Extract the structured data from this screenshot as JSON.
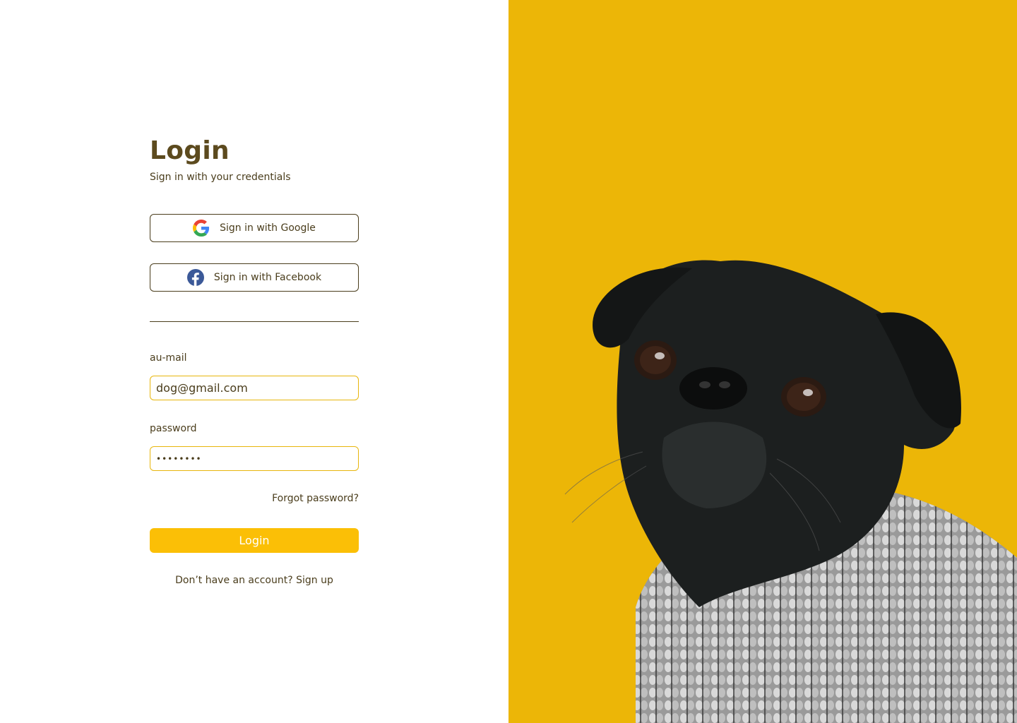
{
  "login": {
    "title": "Login",
    "subtitle": "Sign in with your credentials",
    "google_button": "Sign in with Google",
    "facebook_button": "Sign in with Facebook",
    "email_label": "au-mail",
    "email_value": "dog@gmail.com",
    "password_label": "password",
    "password_value": "••••••••",
    "forgot_password": "Forgot password?",
    "login_button": "Login",
    "signup_prompt": "Don’t have an account?",
    "signup_link": "Sign up"
  },
  "hero": {
    "image_subject": "black-pug-in-sweater-photo",
    "background_color": "#ecb607"
  },
  "colors": {
    "accent": "#fbbf06",
    "text": "#4a3d1c",
    "title": "#5c4a1e",
    "input_border": "#e8b60c"
  },
  "icons": {
    "google": "google-logo-icon",
    "facebook": "facebook-logo-icon"
  }
}
